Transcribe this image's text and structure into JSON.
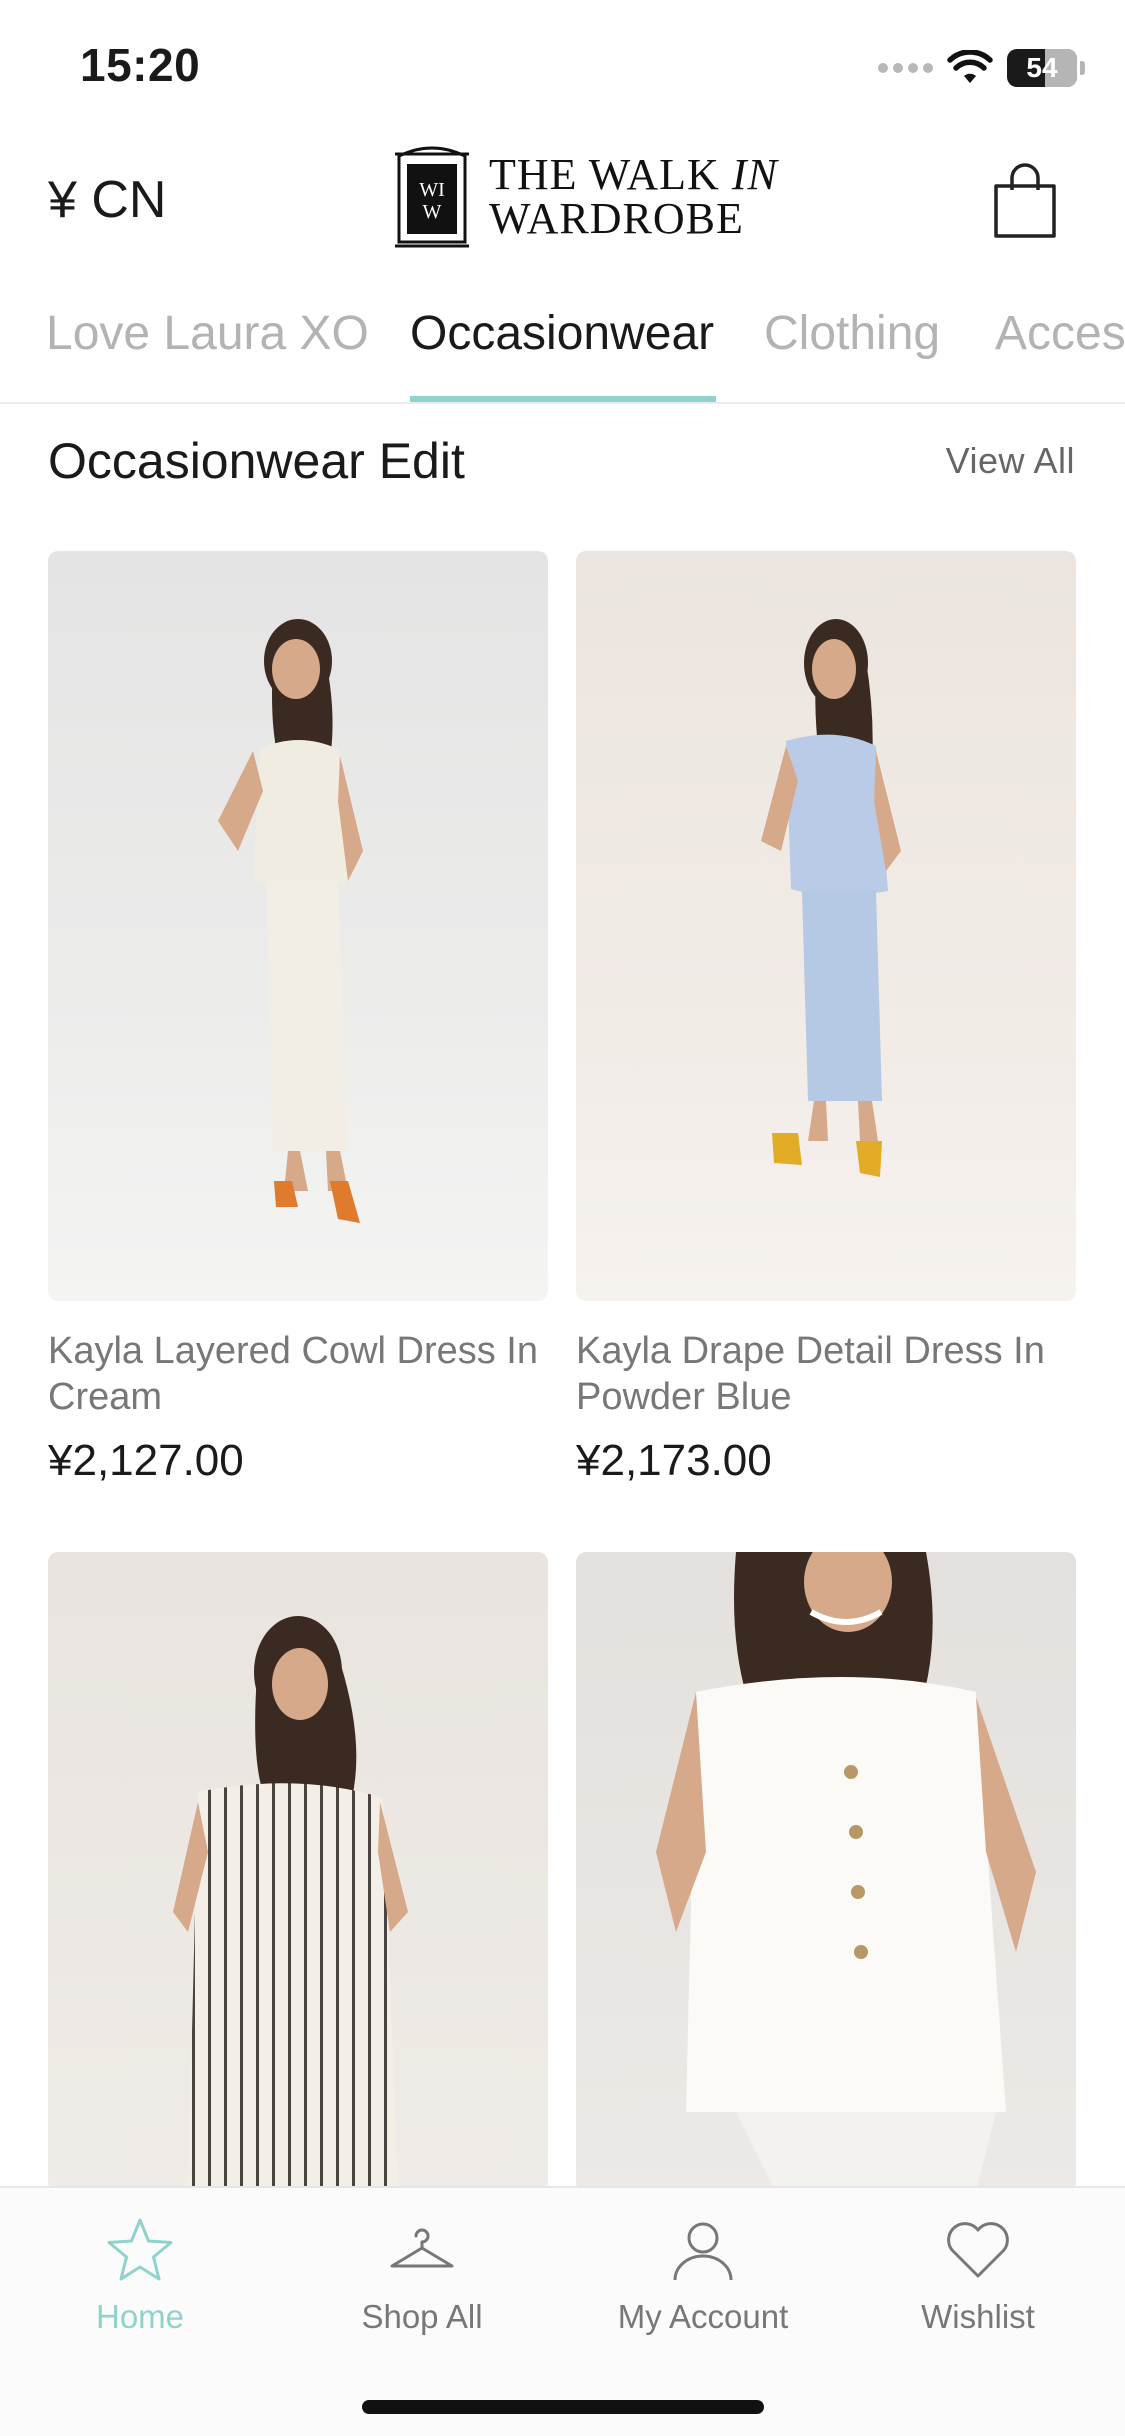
{
  "status": {
    "time": "15:20",
    "battery": "54",
    "battery_level": 0.54
  },
  "header": {
    "currency": "¥ CN",
    "logo_line1_a": "THE WALK ",
    "logo_line1_b": "IN",
    "logo_line2": "WARDROBE",
    "logo_monogram": "WIW"
  },
  "tabs": [
    {
      "label": "Love Laura XO",
      "active": false
    },
    {
      "label": "Occasionwear",
      "active": true
    },
    {
      "label": "Clothing",
      "active": false
    },
    {
      "label": "Accessories",
      "active": false
    }
  ],
  "section": {
    "title": "Occasionwear Edit",
    "view_all": "View All"
  },
  "products": [
    {
      "name": "Kayla Layered Cowl Dress In Cream",
      "price": "¥2,127.00"
    },
    {
      "name": "Kayla Drape Detail Dress In Powder Blue",
      "price": "¥2,173.00"
    },
    {
      "name": "",
      "price": ""
    },
    {
      "name": "",
      "price": ""
    }
  ],
  "tabbar": [
    {
      "label": "Home",
      "icon": "star-icon",
      "active": true
    },
    {
      "label": "Shop All",
      "icon": "hanger-icon",
      "active": false
    },
    {
      "label": "My Account",
      "icon": "person-icon",
      "active": false
    },
    {
      "label": "Wishlist",
      "icon": "heart-icon",
      "active": false
    }
  ],
  "colors": {
    "accent": "#8fd3cc",
    "text": "#1a1a1a",
    "muted": "#777777"
  }
}
